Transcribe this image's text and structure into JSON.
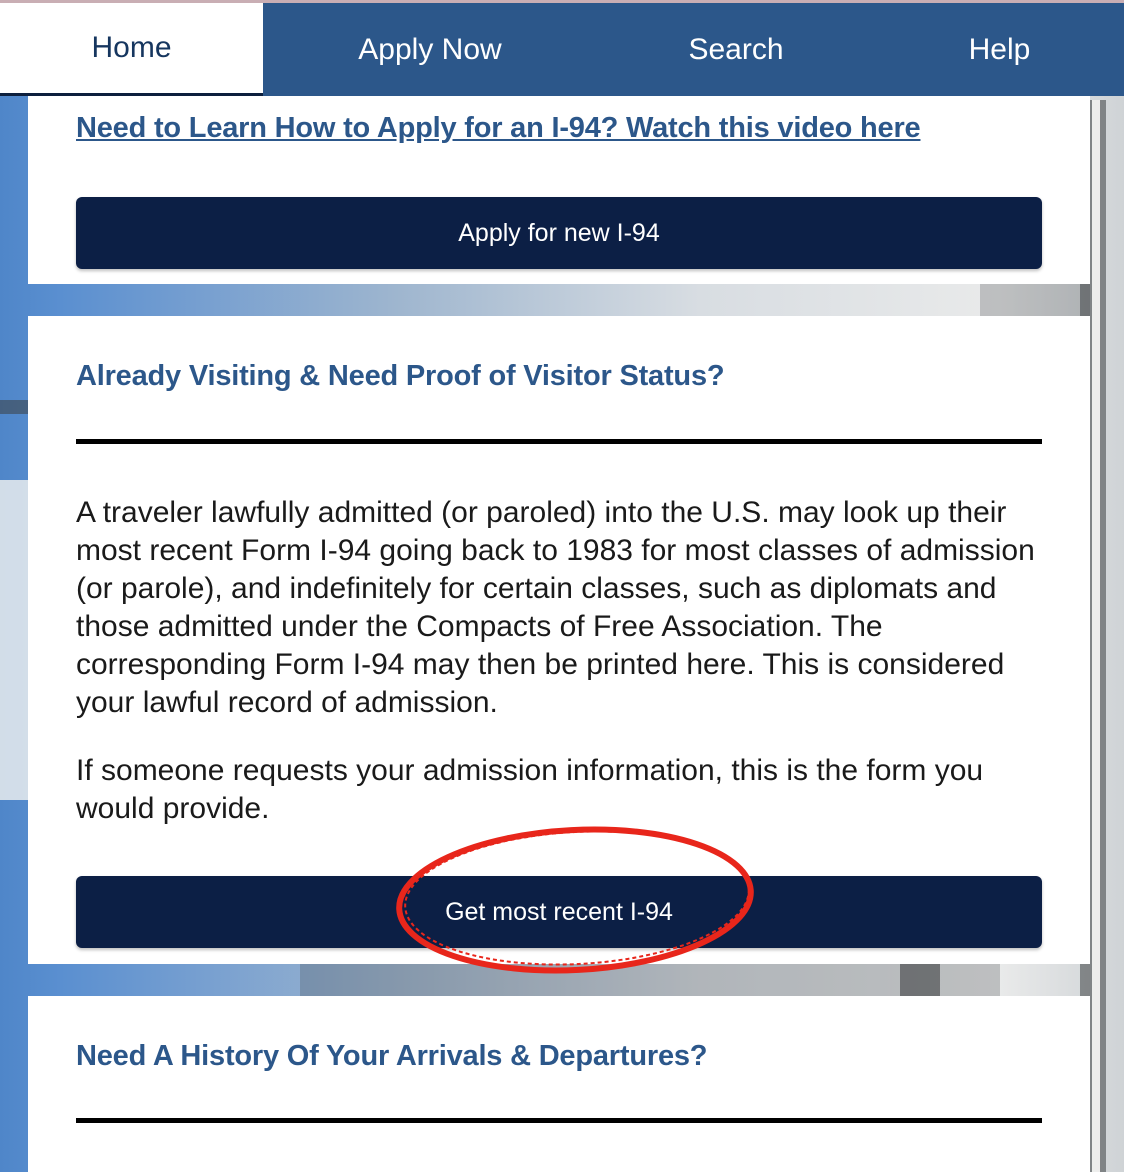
{
  "nav": {
    "items": [
      "Home",
      "Apply Now",
      "Search",
      "Help"
    ],
    "active": "Home"
  },
  "section1": {
    "link": "Need to Learn How to Apply for an I-94? Watch this video here",
    "button": "Apply for new I-94"
  },
  "section2": {
    "heading": "Already Visiting & Need Proof of Visitor Status?",
    "paragraph1": "A traveler lawfully admitted (or paroled) into the U.S. may look up their most recent Form I-94 going back to 1983 for most classes of admission (or parole), and indefinitely for certain classes, such as diplomats and those admitted under the Compacts of Free Association. The corresponding Form I-94 may then be printed here. This is considered your lawful record of admission.",
    "paragraph2": "If someone requests your admission information, this is the form you would provide.",
    "button": "Get most recent I-94"
  },
  "section3": {
    "heading": "Need A History Of Your Arrivals & Departures?"
  },
  "colors": {
    "nav_bg": "#2c578a",
    "button_bg": "#0c1f45",
    "heading": "#2c578a",
    "annotation": "#e8261b"
  }
}
